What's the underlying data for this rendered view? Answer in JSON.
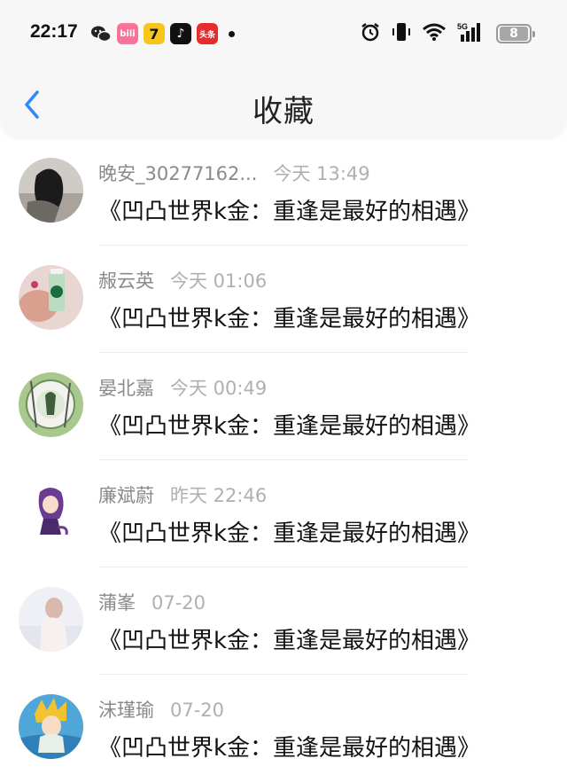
{
  "status_bar": {
    "time": "22:17",
    "battery_level": "8",
    "apps": [
      {
        "icon": "wechat-icon",
        "label": "",
        "color": "#222222"
      },
      {
        "icon": "bilibili-icon",
        "label": "bili",
        "color": "#fb7299"
      },
      {
        "icon": "seven-cats-icon",
        "label": "7",
        "color": "#f7c51c"
      },
      {
        "icon": "tiktok-icon",
        "label": "♪",
        "color": "#111111"
      },
      {
        "icon": "toutiao-icon",
        "label": "头条",
        "color": "#e62d2d"
      }
    ]
  },
  "header": {
    "title": "收藏"
  },
  "items": [
    {
      "name": "晚安_30277162...",
      "time": "今天 13:49",
      "content": "《凹凸世界k金：重逢是最好的相遇》"
    },
    {
      "name": "赧云英",
      "time": "今天 01:06",
      "content": "《凹凸世界k金：重逢是最好的相遇》"
    },
    {
      "name": "晏北嘉",
      "time": "今天 00:49",
      "content": "《凹凸世界k金：重逢是最好的相遇》"
    },
    {
      "name": "廉斌蔚",
      "time": "昨天 22:46",
      "content": "《凹凸世界k金：重逢是最好的相遇》"
    },
    {
      "name": "蒲峯",
      "time": "07-20",
      "content": "《凹凸世界k金：重逢是最好的相遇》"
    },
    {
      "name": "沫瑾瑜",
      "time": "07-20",
      "content": "《凹凸世界k金：重逢是最好的相遇》"
    }
  ],
  "colors": {
    "accent": "#2f88ff",
    "header_bg": "#f7f7f7"
  }
}
